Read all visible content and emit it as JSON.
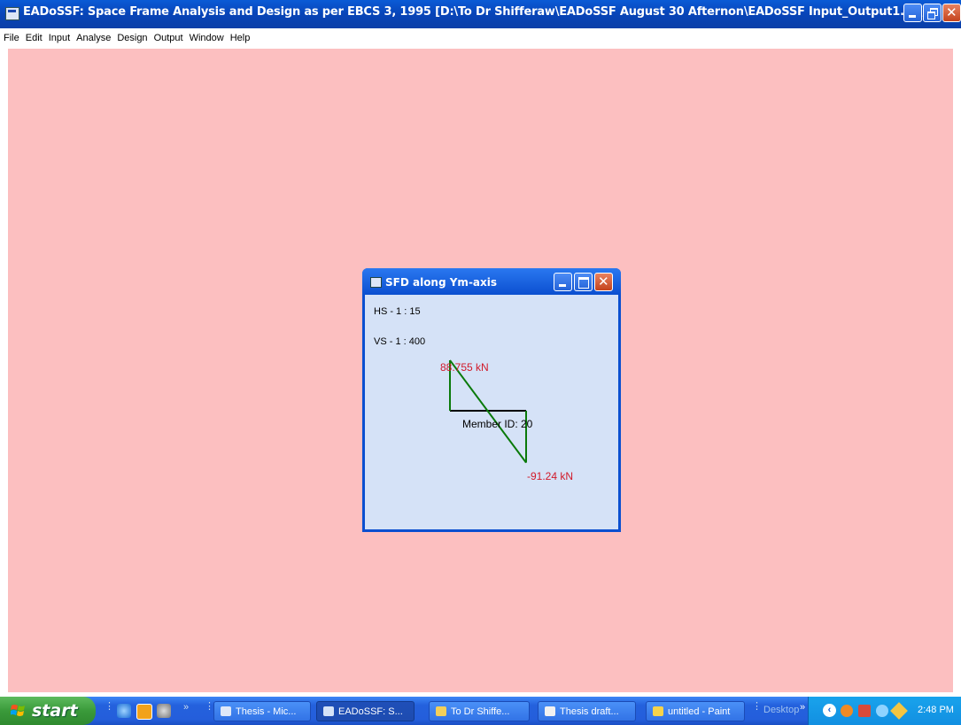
{
  "window": {
    "title": "EADoSSF: Space Frame Analysis and Design as per EBCS 3, 1995 [D:\\To Dr Shifferaw\\EADoSSF August 30 Afternon\\EADoSSF Input_Output1.txt]"
  },
  "menu": [
    "File",
    "Edit",
    "Input",
    "Analyse",
    "Design",
    "Output",
    "Window",
    "Help"
  ],
  "sfd_window": {
    "title": "SFD along Ym-axis",
    "hs_label": "HS - 1 : 15",
    "vs_label": "VS - 1 : 400",
    "top_value_label": "88.755 kN",
    "bottom_value_label": "-91.24 kN",
    "member_label": "Member ID: 20"
  },
  "chart_data": {
    "type": "line",
    "title": "SFD along Ym-axis",
    "member_id": 20,
    "points": [
      {
        "x": 0,
        "y": 88.755
      },
      {
        "x": 1,
        "y": -91.24
      }
    ],
    "labels": [
      "88.755 kN",
      "-91.24 kN"
    ],
    "annotations": [
      "HS - 1 : 15",
      "VS - 1 : 400",
      "Member ID: 20"
    ],
    "series_color": "#0a7a0a",
    "axis_color": "#000000",
    "label_color": "#d11a2a"
  },
  "taskbar": {
    "start_label": "start",
    "items": [
      {
        "label": "Thesis - Mic...",
        "icon": "word-icon"
      },
      {
        "label": "EADoSSF: S...",
        "icon": "app-window-icon",
        "active": true
      },
      {
        "label": "To Dr Shiffe...",
        "icon": "folder-icon"
      },
      {
        "label": "Thesis draft...",
        "icon": "document-icon"
      },
      {
        "label": "untitled - Paint",
        "icon": "paint-icon"
      }
    ],
    "desktop_label": "Desktop",
    "clock": "2:48 PM"
  },
  "colors": {
    "workspace": "#fcbfc0",
    "titlebar": "#0a4fcf",
    "sfd_client": "#d5e2f7",
    "taskbar": "#245edb",
    "start": "#3a9a3a"
  }
}
